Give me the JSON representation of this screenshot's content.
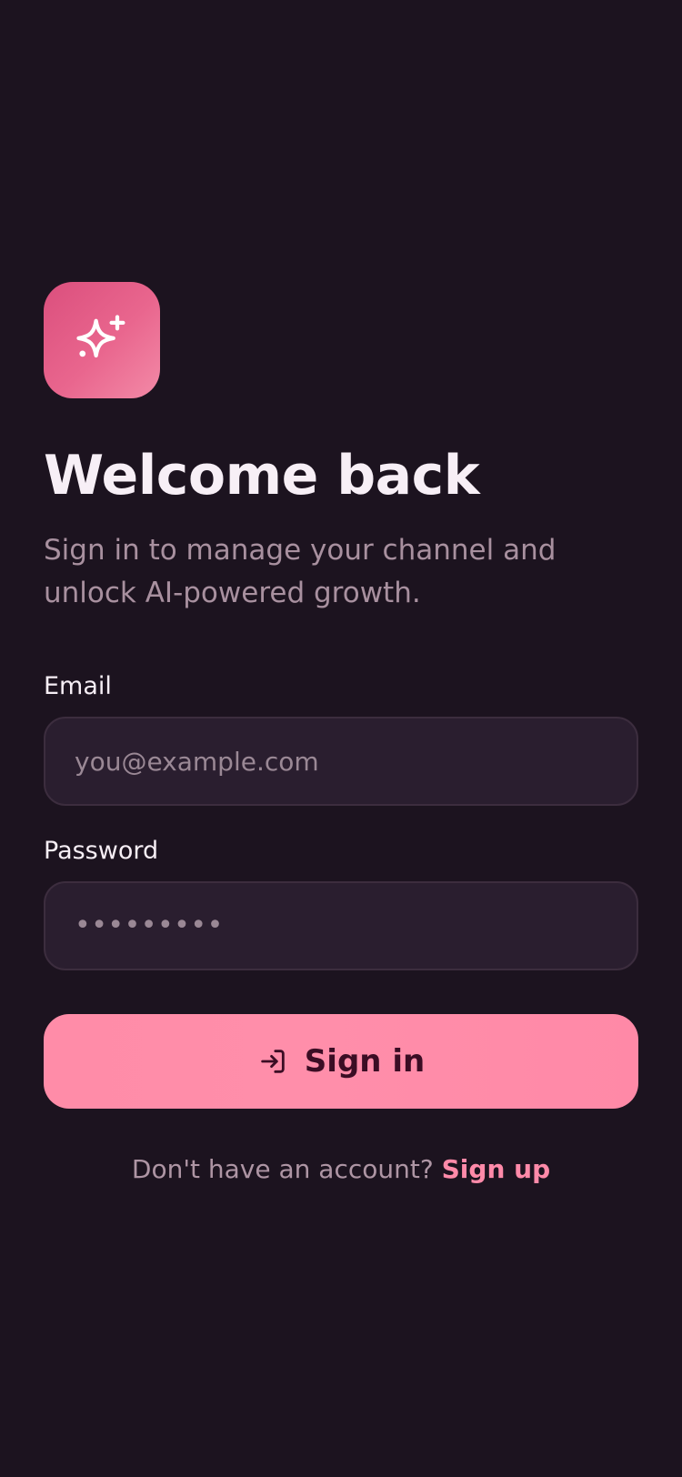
{
  "colors": {
    "background": "#1c131f",
    "input_background": "#2a1e2f",
    "input_border": "#3c2d3e",
    "accent": "#ff8aa9",
    "logo_gradient_start": "#db4f7d",
    "logo_gradient_end": "#f38aa7",
    "button_text": "#3b0d24",
    "muted_text": "#a8909f"
  },
  "branding": {
    "icon": "sparkles-icon"
  },
  "hero": {
    "title": "Welcome back",
    "subtitle": "Sign in to manage your channel and unlock AI-powered growth."
  },
  "form": {
    "email": {
      "label": "Email",
      "placeholder": "you@example.com",
      "value": ""
    },
    "password": {
      "label": "Password",
      "masked_value": "•••••••••"
    },
    "submit": {
      "label": "Sign in",
      "icon": "sign-in-icon"
    }
  },
  "footer": {
    "prompt": "Don't have an account?",
    "link_label": "Sign up"
  }
}
